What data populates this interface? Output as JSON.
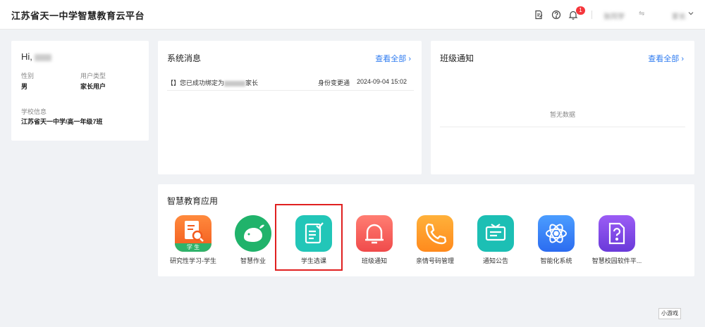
{
  "header": {
    "title": "江苏省天一中学智慧教育云平台",
    "notification_count": "1",
    "user_name": "张同学",
    "role_short": "家长"
  },
  "profile": {
    "greeting": "Hi,",
    "gender_label": "性别",
    "gender_value": "男",
    "user_type_label": "用户类型",
    "user_type_value": "家长用户",
    "school_label": "学校信息",
    "school_value": "江苏省天一中学/高一年级7班"
  },
  "messages": {
    "title": "系统消息",
    "view_all": "查看全部",
    "items": [
      {
        "prefix": "【】您已成功绑定为",
        "suffix": "家长",
        "source": "身份变更通",
        "time": "2024-09-04 15:02"
      }
    ]
  },
  "class_notice": {
    "title": "班级通知",
    "view_all": "查看全部",
    "empty_text": "暂无数据"
  },
  "apps": {
    "title": "智慧教育应用",
    "items": [
      {
        "label": "研究性学习-学生",
        "icon": "research-study-icon",
        "badge": "学 生"
      },
      {
        "label": "智慧作业",
        "icon": "whale-homework-icon"
      },
      {
        "label": "学生选课",
        "icon": "course-selection-icon"
      },
      {
        "label": "班级通知",
        "icon": "bell-icon"
      },
      {
        "label": "亲情号码管理",
        "icon": "phone-icon"
      },
      {
        "label": "通知公告",
        "icon": "announcement-icon"
      },
      {
        "label": "智能化系统",
        "icon": "atom-icon"
      },
      {
        "label": "智慧校园软件平...",
        "icon": "help-document-icon"
      }
    ]
  },
  "corner_tag": "小游戏",
  "colors": {
    "accent": "#2e7bf0",
    "highlight": "#e02020",
    "badge": "#f5363b"
  }
}
